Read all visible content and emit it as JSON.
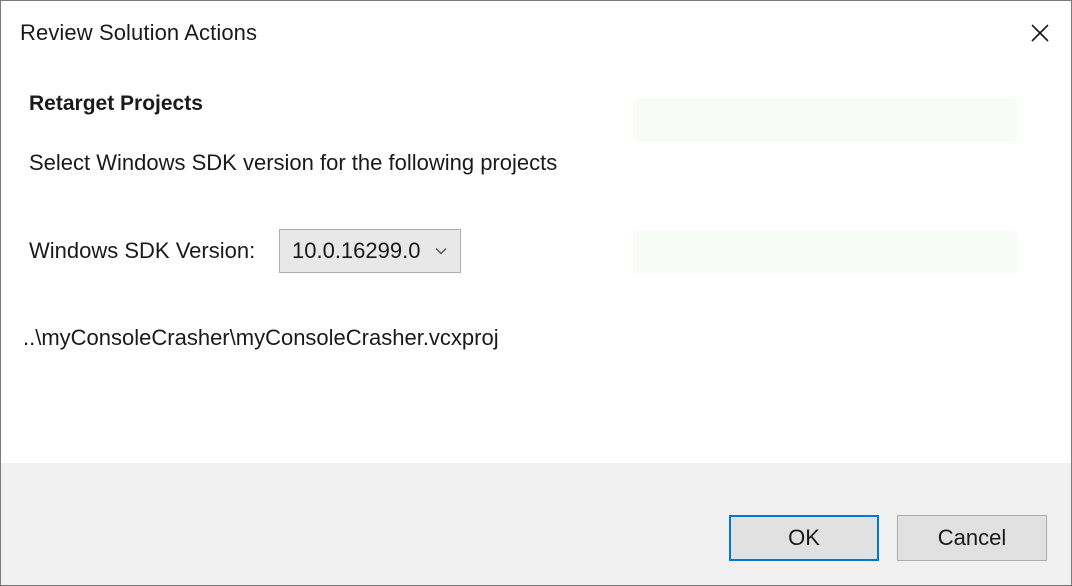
{
  "window": {
    "title": "Review Solution Actions",
    "close_icon": "close-icon"
  },
  "content": {
    "heading": "Retarget Projects",
    "instruction": "Select Windows SDK version for the following projects",
    "sdk_label": "Windows SDK Version:",
    "sdk_select": {
      "selected": "10.0.16299.0",
      "icon": "chevron-down-icon"
    },
    "project_path": "..\\myConsoleCrasher\\myConsoleCrasher.vcxproj"
  },
  "footer": {
    "ok_label": "OK",
    "cancel_label": "Cancel"
  },
  "colors": {
    "accent": "#0078d7",
    "footer_bg": "#f0f0f0",
    "button_bg": "#e1e1e1",
    "select_bg": "#e8e8e8"
  }
}
